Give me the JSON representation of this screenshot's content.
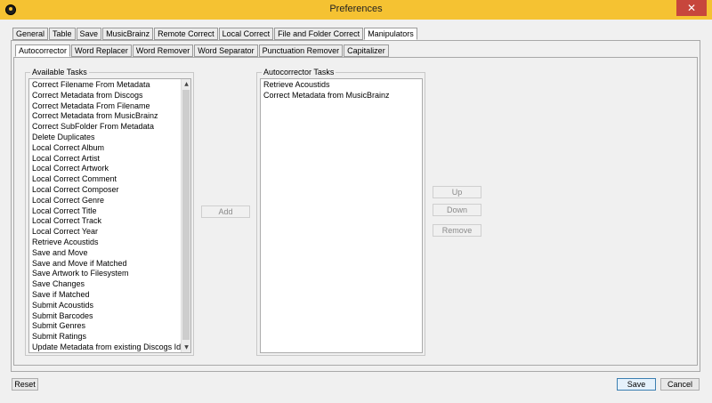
{
  "window": {
    "title": "Preferences",
    "close_glyph": "✕"
  },
  "top_tabs": [
    "General",
    "Table",
    "Save",
    "MusicBrainz",
    "Remote Correct",
    "Local Correct",
    "File and Folder Correct",
    "Manipulators"
  ],
  "top_tabs_active": "Manipulators",
  "sub_tabs": [
    "Autocorrector",
    "Word Replacer",
    "Word Remover",
    "Word Separator",
    "Punctuation Remover",
    "Capitalizer"
  ],
  "sub_tabs_active": "Autocorrector",
  "available_tasks": {
    "title": "Available Tasks",
    "items": [
      "Correct Filename From Metadata",
      "Correct Metadata from Discogs",
      "Correct Metadata From Filename",
      "Correct Metadata from MusicBrainz",
      "Correct SubFolder From Metadata",
      "Delete Duplicates",
      "Local Correct Album",
      "Local Correct Artist",
      "Local Correct Artwork",
      "Local Correct Comment",
      "Local Correct Composer",
      "Local Correct Genre",
      "Local Correct Title",
      "Local Correct Track",
      "Local Correct Year",
      "Retrieve Acoustids",
      "Save and Move",
      "Save and Move if Matched",
      "Save Artwork to Filesystem",
      "Save Changes",
      "Save if Matched",
      "Submit Acoustids",
      "Submit Barcodes",
      "Submit Genres",
      "Submit Ratings",
      "Update Metadata from existing Discogs Ids"
    ]
  },
  "autocorrector_tasks": {
    "title": "Autocorrector Tasks",
    "items": [
      "Retrieve Acoustids",
      "Correct Metadata from MusicBrainz"
    ]
  },
  "buttons": {
    "add": "Add",
    "up": "Up",
    "down": "Down",
    "remove": "Remove",
    "reset": "Reset",
    "save": "Save",
    "cancel": "Cancel"
  },
  "icons": {
    "app": "app-logo-icon",
    "scroll_up": "▲",
    "scroll_down": "▼"
  },
  "colors": {
    "titlebar": "#f5c232",
    "close": "#c7463c"
  }
}
